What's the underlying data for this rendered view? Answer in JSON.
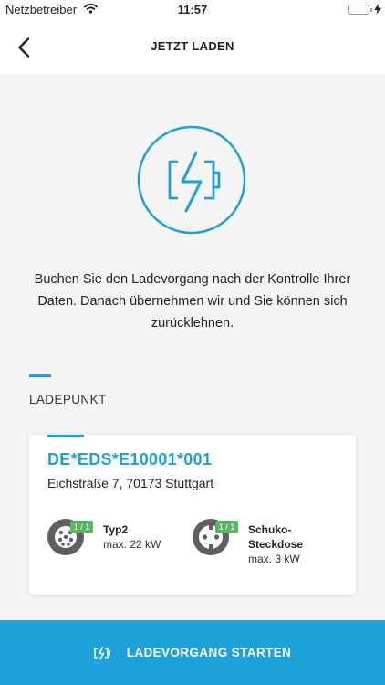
{
  "status_bar": {
    "carrier": "Netzbetreiber",
    "time": "11:57",
    "battery_level": 1.0
  },
  "nav": {
    "title": "JETZT LADEN",
    "back_icon": "chevron-left-icon"
  },
  "hero": {
    "icon": "battery-charging-icon"
  },
  "description": "Buchen Sie den Ladevorgang nach der Kontrolle Ihrer Daten. Danach übernehmen wir und Sie können sich zurücklehnen.",
  "section": {
    "label": "LADEPUNKT"
  },
  "charge_point": {
    "id": "DE*EDS*E10001*001",
    "address": "Eichstraße 7, 70173 Stuttgart",
    "connectors": [
      {
        "name": "Typ2",
        "power": "max. 22 kW",
        "availability": "1 / 1",
        "icon": "type2-plug-icon"
      },
      {
        "name": "Schuko-Steckdose",
        "name_lines": [
          "Schuko-",
          "Steckdose"
        ],
        "power": "max. 3 kW",
        "availability": "1 / 1",
        "icon": "schuko-plug-icon"
      }
    ]
  },
  "action": {
    "label": "LADEVORGANG STARTEN",
    "icon": "charging-icon"
  },
  "colors": {
    "accent": "#1ea0da",
    "available_badge": "#5db462",
    "plug_icon": "#5f5f5f",
    "background": "#f5f5f5"
  }
}
